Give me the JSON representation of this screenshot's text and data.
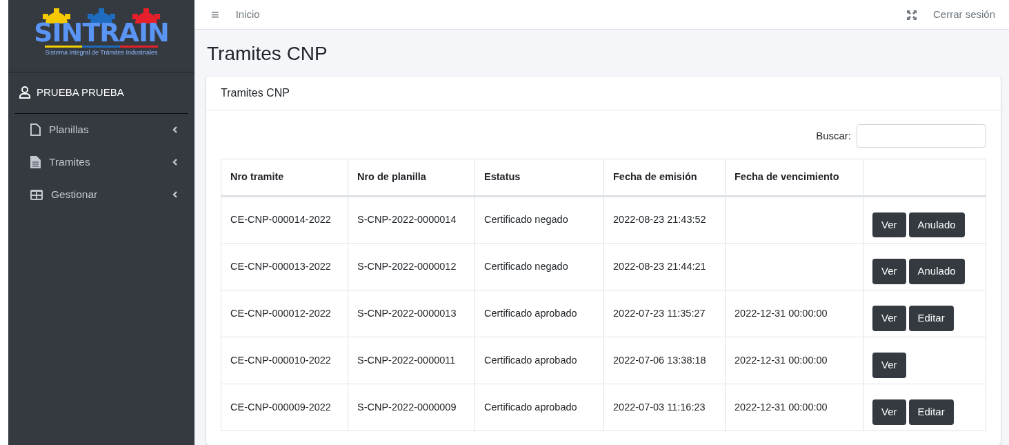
{
  "logo": {
    "title": "SINTRAIN",
    "subtitle": "Sistema Integral de Trámites Industriales"
  },
  "user": {
    "name": "PRUEBA PRUEBA"
  },
  "sidebar": {
    "items": [
      {
        "label": "Planillas",
        "kind": "file",
        "expanded": false
      },
      {
        "label": "Tramites",
        "kind": "document",
        "expanded": false
      },
      {
        "label": "Gestionar",
        "kind": "grid",
        "expanded": false
      }
    ]
  },
  "topbar": {
    "menu": "≡",
    "links": [
      "Inicio"
    ],
    "logout": "Cerrar sesión"
  },
  "page_title": "Tramites CNP",
  "card": {
    "title": "Tramites CNP",
    "search": {
      "label": "Buscar:"
    },
    "table": {
      "columns": [
        "Nro tramite",
        "Nro de planilla",
        "Estatus",
        "Fecha de emisión",
        "Fecha de vencimiento"
      ],
      "rows": [
        {
          "cells": [
            "CE-CNP-000014-2022",
            "S-CNP-2022-0000014",
            "Certificado negado",
            "2022-08-23 21:43:52",
            ""
          ],
          "actions": [
            "Ver",
            "Anulado"
          ]
        },
        {
          "cells": [
            "CE-CNP-000013-2022",
            "S-CNP-2022-0000012",
            "Certificado negado",
            "2022-08-23 21:44:21",
            ""
          ],
          "actions": [
            "Ver",
            "Anulado"
          ]
        },
        {
          "cells": [
            "CE-CNP-000012-2022",
            "S-CNP-2022-0000013",
            "Certificado aprobado",
            "2022-07-23 11:35:27",
            "2022-12-31 00:00:00"
          ],
          "actions": [
            "Ver",
            "Editar"
          ]
        },
        {
          "cells": [
            "CE-CNP-000010-2022",
            "S-CNP-2022-0000011",
            "Certificado aprobado",
            "2022-07-06 13:38:18",
            "2022-12-31 00:00:00"
          ],
          "actions": [
            "Ver"
          ]
        },
        {
          "cells": [
            "CE-CNP-000009-2022",
            "S-CNP-2022-0000009",
            "Certificado aprobado",
            "2022-07-03 11:16:23",
            "2022-12-31 00:00:00"
          ],
          "actions": [
            "Ver",
            "Editar"
          ]
        }
      ]
    }
  }
}
